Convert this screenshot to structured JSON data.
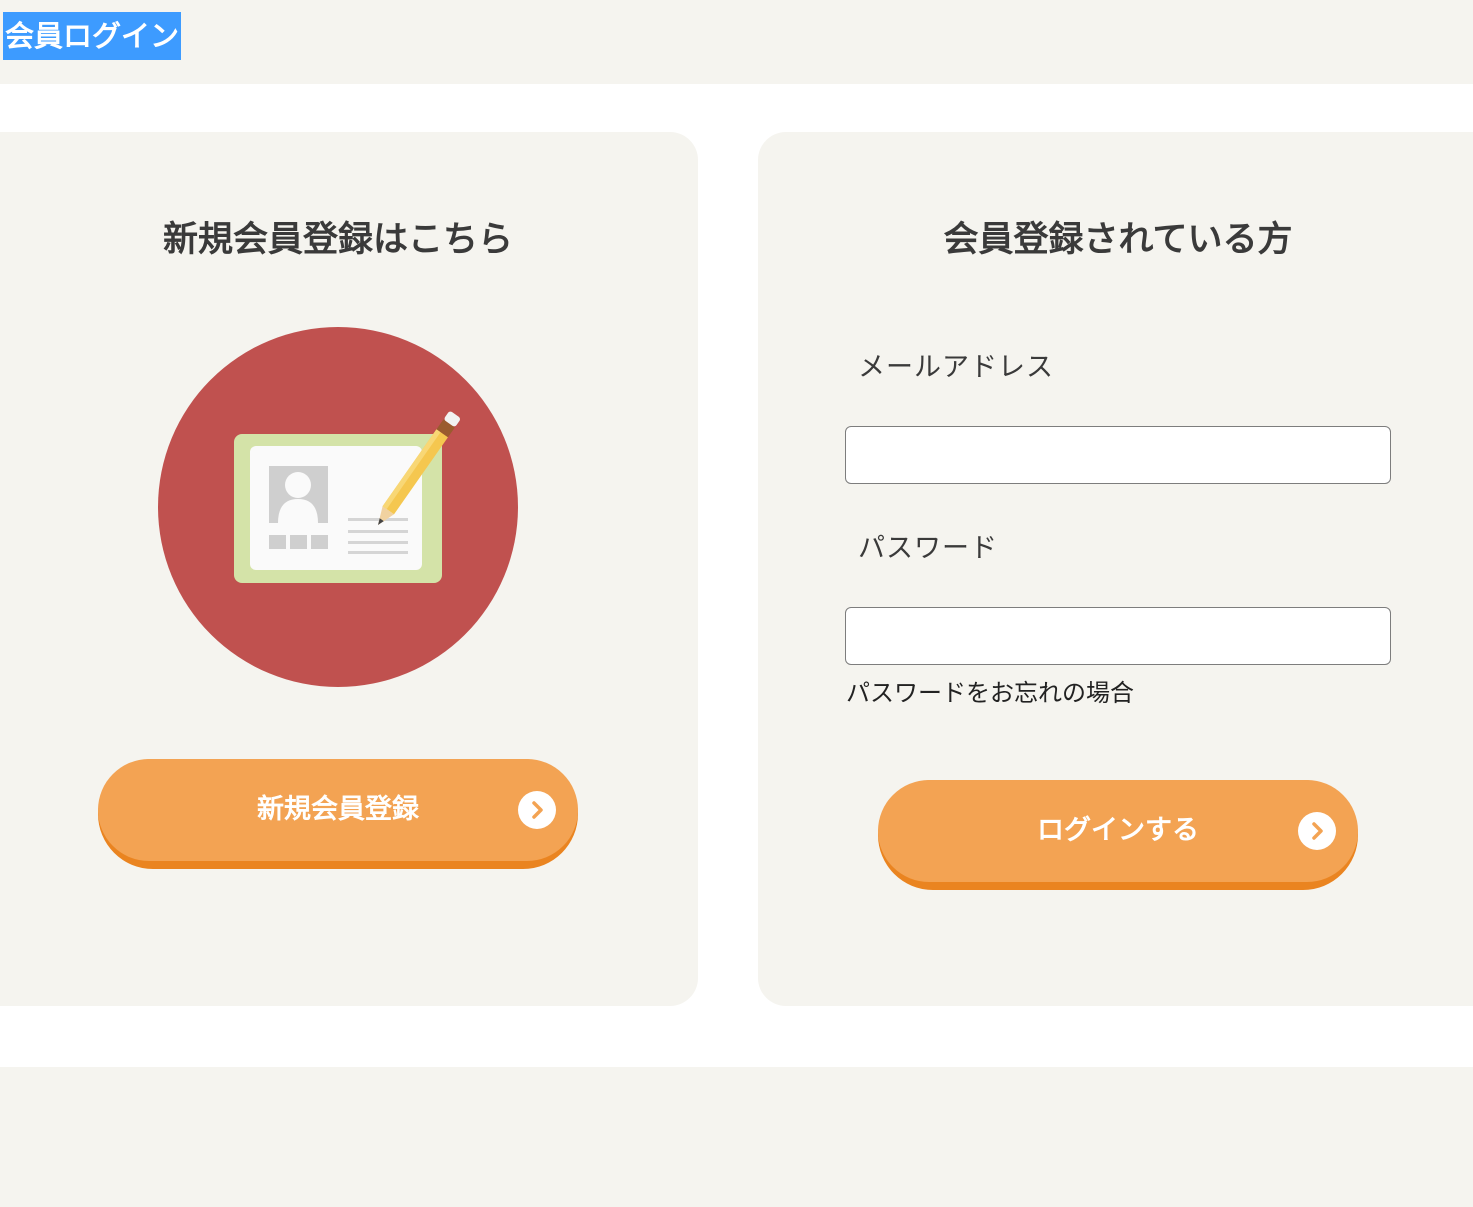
{
  "header": {
    "title": "会員ログイン"
  },
  "register_card": {
    "heading": "新規会員登録はこちら",
    "button_label": "新規会員登録"
  },
  "login_card": {
    "heading": "会員登録されている方",
    "email_label": "メールアドレス",
    "email_value": "",
    "password_label": "パスワード",
    "password_value": "",
    "forgot_password_link": "パスワードをお忘れの場合",
    "button_label": "ログインする"
  },
  "icons": {
    "illustration": "member-card-pencil-illustration",
    "button_arrow": "chevron-right-icon"
  },
  "colors": {
    "page_background": "#ffffff",
    "card_background": "#f5f4ef",
    "title_highlight": "#3d9bff",
    "button_face": "#f3a353",
    "button_shadow": "#ea8420",
    "illustration_circle": "#c0514f"
  }
}
